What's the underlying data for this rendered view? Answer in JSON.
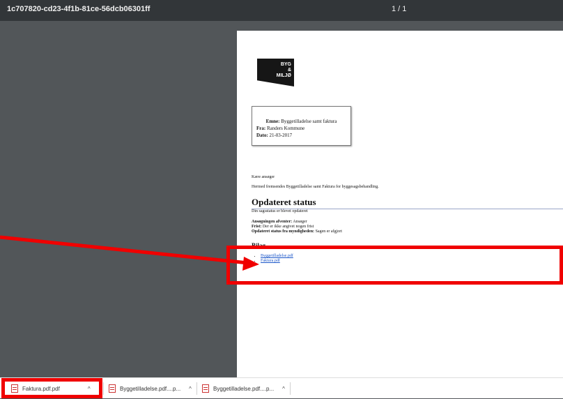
{
  "topbar": {
    "file_title": "1c707820-cd23-4f1b-81ce-56dcb06301ff",
    "page_counter": "1 / 1"
  },
  "document": {
    "logo": {
      "line1": "BYG",
      "line2": "&",
      "line3": "MILJØ"
    },
    "infobox": {
      "emne_label": "Emne:",
      "emne_value": "Byggetilladelse samt faktura",
      "fra_label": "Fra:",
      "fra_value": "Randers Kommune",
      "dato_label": "Dato:",
      "dato_value": "21-03-2017"
    },
    "greeting": "Kære ansøger",
    "intro": "Hermed fremsendes Byggetilladelse samt Faktura for byggesagsbehandling.",
    "heading": "Opdateret status",
    "status_text": "Din sagsstatus er blevet opdateret",
    "details": [
      {
        "label": "Ansøgningen afventer:",
        "value": "Ansøger"
      },
      {
        "label": "Frist:",
        "value": "Der er ikke angivet nogen frist"
      },
      {
        "label": "Opdateret status fra myndigheden:",
        "value": "Sagen er afgjort"
      }
    ],
    "attachments_title": "Bilag",
    "attachments": [
      "Byggetilladelse.pdf",
      "Faktura.pdf"
    ]
  },
  "downloads": [
    {
      "name": "Faktura.pdf.pdf"
    },
    {
      "name": "Byggetilladelse.pdf....p..."
    },
    {
      "name": "Byggetilladelse.pdf....p..."
    }
  ],
  "colors": {
    "annotation": "#f00000",
    "link": "#1a56c9",
    "toolbar": "#323639",
    "viewer_bg": "#525659"
  },
  "icons": {
    "download_file": "pdf-file-icon",
    "expand": "chevron-up-icon"
  }
}
